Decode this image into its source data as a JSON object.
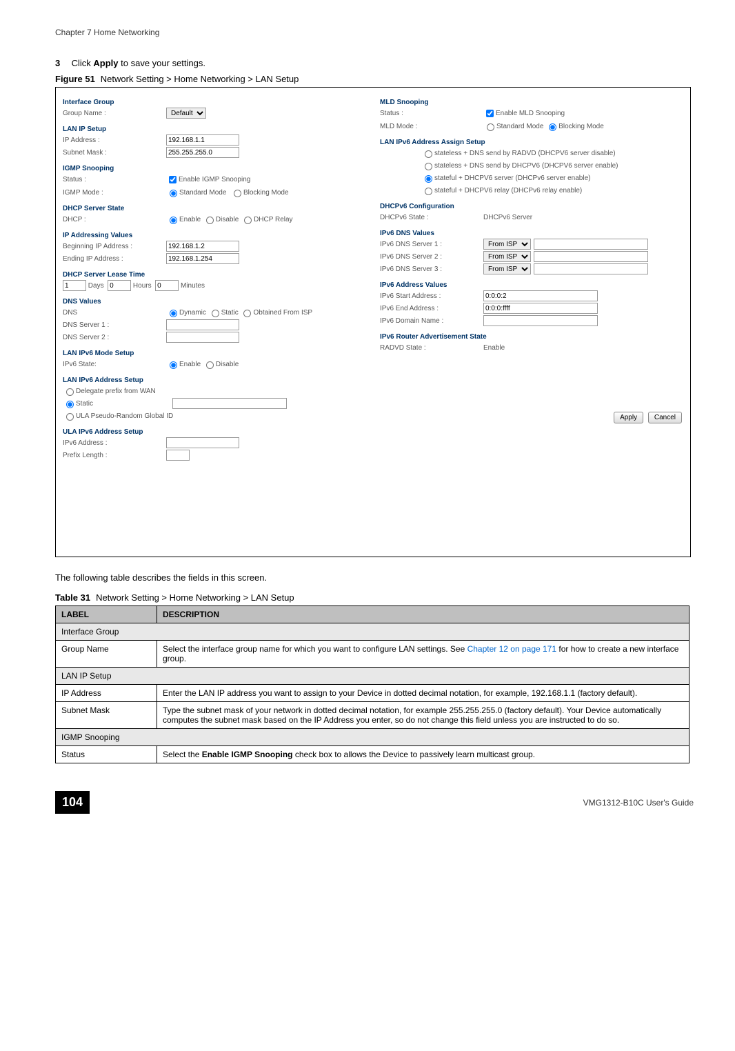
{
  "header": {
    "chapter": "Chapter 7 Home Networking"
  },
  "step": {
    "number": "3",
    "text_before": "Click ",
    "bold_word": "Apply",
    "text_after": " to save your settings."
  },
  "figure": {
    "label": "Figure 51",
    "title": "Network Setting > Home Networking > LAN Setup"
  },
  "screenshot": {
    "left": {
      "interface_group_h": "Interface Group",
      "group_name_lbl": "Group Name :",
      "group_name_val": "Default",
      "lan_ip_h": "LAN IP Setup",
      "ip_address_lbl": "IP Address :",
      "ip_address_val": "192.168.1.1",
      "subnet_mask_lbl": "Subnet Mask :",
      "subnet_mask_val": "255.255.255.0",
      "igmp_h": "IGMP Snooping",
      "igmp_status_lbl": "Status :",
      "igmp_status_chk": "Enable IGMP Snooping",
      "igmp_mode_lbl": "IGMP Mode :",
      "igmp_mode_std": "Standard Mode",
      "igmp_mode_blk": "Blocking Mode",
      "dhcp_state_h": "DHCP Server State",
      "dhcp_lbl": "DHCP :",
      "dhcp_enable": "Enable",
      "dhcp_disable": "Disable",
      "dhcp_relay": "DHCP Relay",
      "ip_values_h": "IP Addressing Values",
      "begin_ip_lbl": "Beginning IP Address :",
      "begin_ip_val": "192.168.1.2",
      "end_ip_lbl": "Ending IP Address :",
      "end_ip_val": "192.168.1.254",
      "lease_h": "DHCP Server Lease Time",
      "lease_days_val": "1",
      "lease_days_lbl": "Days",
      "lease_hours_val": "0",
      "lease_hours_lbl": "Hours",
      "lease_min_val": "0",
      "lease_min_lbl": "Minutes",
      "dns_h": "DNS Values",
      "dns_lbl": "DNS",
      "dns_dynamic": "Dynamic",
      "dns_static": "Static",
      "dns_isp": "Obtained From ISP",
      "dns_s1_lbl": "DNS Server 1 :",
      "dns_s2_lbl": "DNS Server 2 :",
      "ipv6_mode_h": "LAN IPv6 Mode Setup",
      "ipv6_state_lbl": "IPv6 State:",
      "ipv6_enable": "Enable",
      "ipv6_disable": "Disable",
      "ipv6_addr_h": "LAN IPv6 Address Setup",
      "ipv6_delegate": "Delegate prefix from WAN",
      "ipv6_static": "Static",
      "ipv6_ula": "ULA Pseudo-Random Global ID",
      "ula_h": "ULA IPv6 Address Setup",
      "ula_addr_lbl": "IPv6 Address :",
      "ula_prefix_lbl": "Prefix Length :"
    },
    "right": {
      "mld_h": "MLD Snooping",
      "mld_status_lbl": "Status :",
      "mld_status_chk": "Enable MLD Snooping",
      "mld_mode_lbl": "MLD Mode :",
      "mld_mode_std": "Standard Mode",
      "mld_mode_blk": "Blocking Mode",
      "ipv6_assign_h": "LAN IPv6 Address Assign Setup",
      "assign_opt1": "stateless + DNS send by RADVD (DHCPV6 server disable)",
      "assign_opt2": "stateless + DNS send by DHCPV6 (DHCPV6 server enable)",
      "assign_opt3": "stateful + DHCPV6 server (DHCPv6 server enable)",
      "assign_opt4": "stateful + DHCPV6 relay (DHCPv6 relay enable)",
      "dhcpv6_conf_h": "DHCPv6 Configuration",
      "dhcpv6_state_lbl": "DHCPv6 State :",
      "dhcpv6_state_val": "DHCPv6 Server",
      "ipv6_dns_h": "IPv6 DNS Values",
      "ipv6_dns1_lbl": "IPv6 DNS Server 1 :",
      "ipv6_dns2_lbl": "IPv6 DNS Server 2 :",
      "ipv6_dns3_lbl": "IPv6 DNS Server 3 :",
      "ipv6_dns_from_isp": "From ISP",
      "ipv6_addr_vals_h": "IPv6 Address Values",
      "ipv6_start_lbl": "IPv6 Start Address :",
      "ipv6_start_val": "0:0:0:2",
      "ipv6_end_lbl": "IPv6 End Address :",
      "ipv6_end_val": "0:0:0:ffff",
      "ipv6_domain_lbl": "IPv6 Domain Name :",
      "radvd_h": "IPv6 Router Advertisement State",
      "radvd_lbl": "RADVD State :",
      "radvd_val": "Enable",
      "apply_btn": "Apply",
      "cancel_btn": "Cancel"
    }
  },
  "body_text": "The following table describes the fields in this screen.",
  "table": {
    "caption_label": "Table 31",
    "caption_title": "Network Setting > Home Networking > LAN Setup",
    "headers": {
      "label": "LABEL",
      "description": "DESCRIPTION"
    },
    "rows": [
      {
        "type": "section",
        "text": "Interface Group"
      },
      {
        "type": "row",
        "label": "Group Name",
        "desc_before": "Select the interface group name for which you want to configure LAN settings. See ",
        "link": "Chapter 12 on page 171",
        "desc_after": " for how to create a new interface group."
      },
      {
        "type": "section",
        "text": "LAN IP Setup"
      },
      {
        "type": "row",
        "label": "IP Address",
        "desc": "Enter the LAN IP address you want to assign to your Device in dotted decimal notation, for example, 192.168.1.1 (factory default)."
      },
      {
        "type": "row",
        "label": "Subnet Mask",
        "desc": "Type the subnet mask of your network in dotted decimal notation, for example 255.255.255.0 (factory default). Your Device automatically computes the subnet mask based on the IP Address you enter, so do not change this field unless you are instructed to do so."
      },
      {
        "type": "section",
        "text": "IGMP Snooping"
      },
      {
        "type": "row",
        "label": "Status",
        "desc_before": "Select the ",
        "bold": "Enable IGMP Snooping",
        "desc_after": " check box to allows the Device to passively learn multicast group."
      }
    ]
  },
  "footer": {
    "page_number": "104",
    "guide": "VMG1312-B10C User's Guide"
  }
}
